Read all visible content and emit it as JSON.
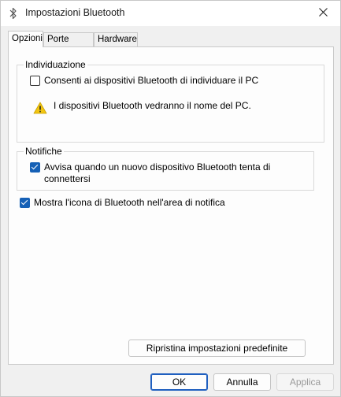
{
  "window": {
    "title": "Impostazioni Bluetooth"
  },
  "tabs": [
    {
      "label": "Opzioni",
      "active": true
    },
    {
      "label": "Porte COM",
      "active": false
    },
    {
      "label": "Hardware",
      "active": false
    }
  ],
  "discovery": {
    "label": "Individuazione",
    "allow_label": "Consenti ai dispositivi Bluetooth di individuare il PC",
    "allow_checked": false,
    "warning_text": "I dispositivi Bluetooth vedranno il nome del PC."
  },
  "notifications": {
    "label": "Notifiche",
    "alert_line1": "Avvisa quando un nuovo dispositivo Bluetooth tenta di",
    "alert_line2": "connettersi",
    "alert_checked": true
  },
  "tray": {
    "label": "Mostra l'icona di Bluetooth nell'area di notifica",
    "checked": true
  },
  "buttons": {
    "restore": "Ripristina impostazioni predefinite",
    "ok": "OK",
    "cancel": "Annulla",
    "apply": "Applica"
  },
  "colors": {
    "accent": "#1560b6",
    "warning": "#f2c511"
  },
  "icons": {
    "title": "bluetooth-icon",
    "close": "close-icon",
    "warning": "warning-icon"
  }
}
